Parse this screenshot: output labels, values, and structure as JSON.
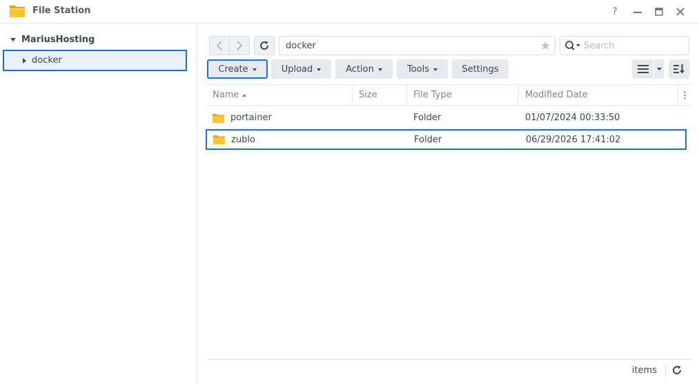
{
  "window": {
    "title": "File Station",
    "help_label": "?",
    "icon": "folder-app-icon",
    "accent_color": "#1a6ed8"
  },
  "sidebar": {
    "root_label": "MariusHosting",
    "items": [
      {
        "label": "docker",
        "selected": true
      }
    ]
  },
  "toolbar": {
    "path": "docker",
    "search_placeholder": "Search",
    "create_label": "Create",
    "upload_label": "Upload",
    "action_label": "Action",
    "tools_label": "Tools",
    "settings_label": "Settings"
  },
  "table": {
    "columns": {
      "name": "Name",
      "size": "Size",
      "type": "File Type",
      "date": "Modified Date"
    },
    "rows": [
      {
        "name": "portainer",
        "size": "",
        "type": "Folder",
        "date": "01/07/2024 00:33:50"
      },
      {
        "name": "zublo",
        "size": "",
        "type": "Folder",
        "date": "06/29/2026 17:41:02",
        "highlighted": true
      }
    ]
  },
  "footer": {
    "items_label": "items"
  }
}
